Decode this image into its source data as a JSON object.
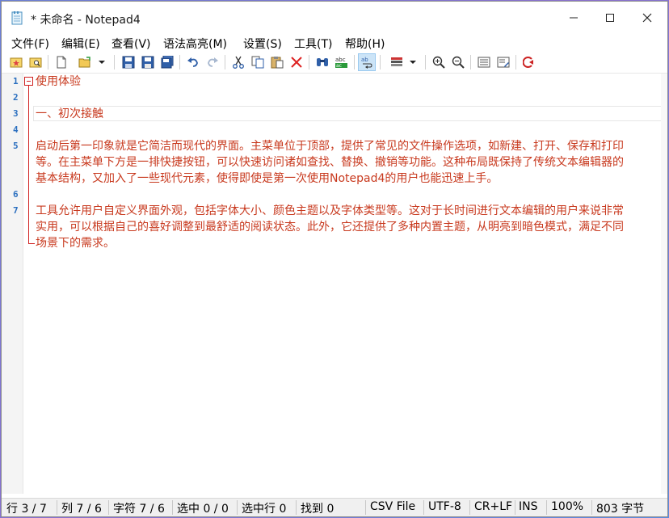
{
  "window": {
    "title": "* 未命名 - Notepad4"
  },
  "menu": [
    "文件(F)",
    "编辑(E)",
    "查看(V)",
    "语法高亮(M)",
    "设置(S)",
    "工具(T)",
    "帮助(H)"
  ],
  "toolbar": {
    "icons": [
      "favorites-icon",
      "find-in-files-icon",
      "new-file-icon",
      "open-file-icon",
      "dropdown-icon",
      "save-icon",
      "save-as-icon",
      "save-copy-icon",
      "undo-icon",
      "redo-icon",
      "cut-icon",
      "copy-icon",
      "paste-icon",
      "delete-icon",
      "find-icon",
      "replace-icon",
      "word-wrap-icon",
      "scheme-icon",
      "dropdown-icon",
      "zoom-in-icon",
      "zoom-out-icon",
      "view-icon",
      "settings-icon",
      "exit-icon"
    ]
  },
  "editor": {
    "line_numbers": [
      "1",
      "2",
      "3",
      "4",
      "5",
      "6",
      "7"
    ],
    "lines": [
      "使用体验",
      "",
      "一、初次接触",
      "",
      "启动后第一印象就是它简洁而现代的界面。主菜单位于顶部，提供了常见的文件操作选项，如新建、打开、保存和打印",
      "等。在主菜单下方是一排快捷按钮，可以快速访问诸如查找、替换、撤销等功能。这种布局既保持了传统文本编辑器的",
      "基本结构，又加入了一些现代元素，使得即使是第一次使用Notepad4的用户也能迅速上手。",
      "",
      "工具允许用户自定义界面外观，包括字体大小、颜色主题以及字体类型等。这对于长时间进行文本编辑的用户来说非常",
      "实用，可以根据自己的喜好调整到最舒适的阅读状态。此外，它还提供了多种内置主题，从明亮到暗色模式，满足不同",
      "场景下的需求。"
    ],
    "text_color": "#c8391e"
  },
  "status": {
    "line": "行 3 / 7",
    "col": "列 7 / 6",
    "char": "字符 7 / 6",
    "sel": "选中 0 / 0",
    "sel_lines": "选中行 0",
    "found": "找到 0",
    "lexer": "CSV File",
    "encoding": "UTF-8",
    "eol": "CR+LF",
    "ovr": "INS",
    "zoom": "100%",
    "size": "803 字节"
  }
}
